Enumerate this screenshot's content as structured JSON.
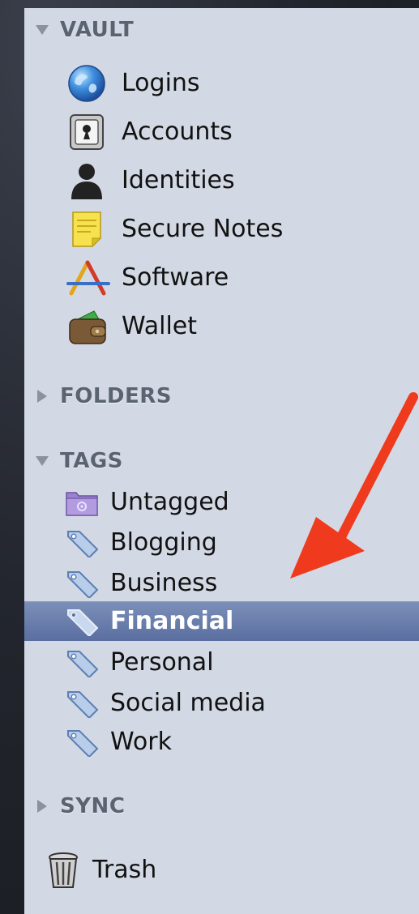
{
  "sections": {
    "vault": {
      "header": "VAULT",
      "expanded": true,
      "items": [
        {
          "label": "Logins",
          "icon": "globe-icon"
        },
        {
          "label": "Accounts",
          "icon": "safe-icon"
        },
        {
          "label": "Identities",
          "icon": "person-icon"
        },
        {
          "label": "Secure Notes",
          "icon": "note-icon"
        },
        {
          "label": "Software",
          "icon": "app-store-icon"
        },
        {
          "label": "Wallet",
          "icon": "wallet-icon"
        }
      ]
    },
    "folders": {
      "header": "FOLDERS",
      "expanded": false
    },
    "tags": {
      "header": "TAGS",
      "expanded": true,
      "items": [
        {
          "label": "Untagged",
          "icon": "untagged-folder-icon"
        },
        {
          "label": "Blogging",
          "icon": "tag-icon"
        },
        {
          "label": "Business",
          "icon": "tag-icon"
        },
        {
          "label": "Financial",
          "icon": "tag-icon",
          "selected": true
        },
        {
          "label": "Personal",
          "icon": "tag-icon"
        },
        {
          "label": "Social media",
          "icon": "tag-icon"
        },
        {
          "label": "Work",
          "icon": "tag-icon"
        }
      ]
    },
    "sync": {
      "header": "SYNC",
      "expanded": false
    },
    "trash": {
      "label": "Trash",
      "icon": "trash-icon"
    }
  },
  "colors": {
    "sidebar_bg": "#d3d9e4",
    "selection": "#6b7fae",
    "arrow": "#f03a1e"
  }
}
